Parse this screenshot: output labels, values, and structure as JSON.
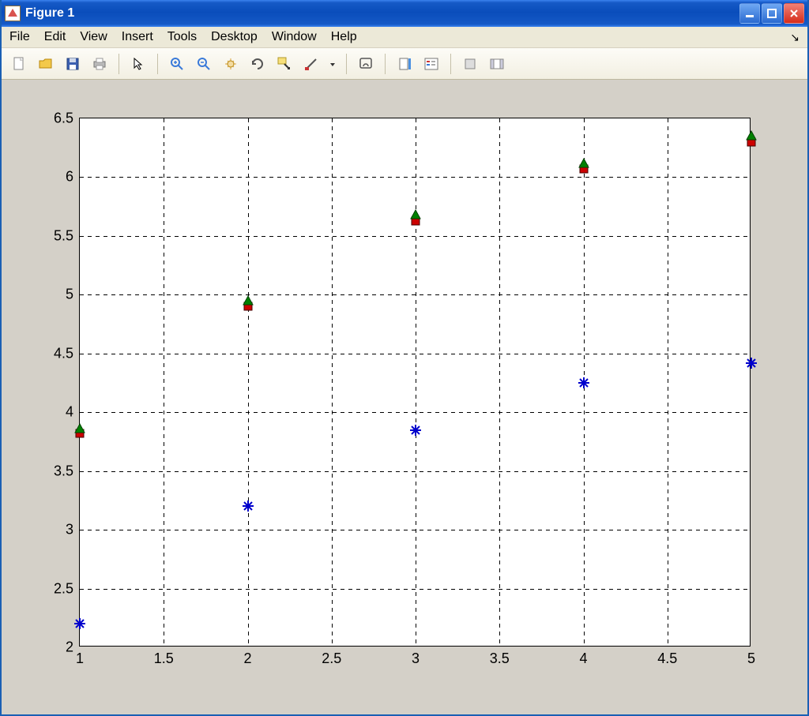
{
  "window": {
    "title": "Figure 1"
  },
  "menubar": {
    "items": [
      "File",
      "Edit",
      "View",
      "Insert",
      "Tools",
      "Desktop",
      "Window",
      "Help"
    ]
  },
  "toolbar": {
    "icons": [
      "new-file-icon",
      "open-folder-icon",
      "save-icon",
      "print-icon",
      "|",
      "pointer-icon",
      "|",
      "zoom-in-icon",
      "zoom-out-icon",
      "pan-icon",
      "rotate-icon",
      "data-cursor-icon",
      "brush-icon",
      "dropdown-icon",
      "|",
      "link-icon",
      "|",
      "colorbar-icon",
      "legend-icon",
      "|",
      "hide-icon",
      "dock-icon"
    ]
  },
  "chart_data": {
    "type": "scatter",
    "xlim": [
      1,
      5
    ],
    "ylim": [
      2,
      6.5
    ],
    "xticks": [
      1,
      1.5,
      2,
      2.5,
      3,
      3.5,
      4,
      4.5,
      5
    ],
    "yticks": [
      2,
      2.5,
      3,
      3.5,
      4,
      4.5,
      5,
      5.5,
      6,
      6.5
    ],
    "xtick_labels": [
      "1",
      "1.5",
      "2",
      "2.5",
      "3",
      "3.5",
      "4",
      "4.5",
      "5"
    ],
    "ytick_labels": [
      "2",
      "2.5",
      "3",
      "3.5",
      "4",
      "4.5",
      "5",
      "5.5",
      "6",
      "6.5"
    ],
    "x": [
      1,
      2,
      3,
      4,
      5
    ],
    "series": [
      {
        "name": "series-blue-star",
        "color": "#0000cc",
        "marker": "star",
        "values": [
          2.2,
          3.2,
          3.85,
          4.25,
          4.42
        ]
      },
      {
        "name": "series-red-square",
        "color": "#cc0000",
        "marker": "square",
        "values": [
          3.82,
          4.9,
          5.63,
          6.07,
          6.3
        ]
      },
      {
        "name": "series-green-tri",
        "color": "#008000",
        "marker": "triangle",
        "values": [
          3.86,
          4.95,
          5.68,
          6.12,
          6.35
        ]
      }
    ],
    "grid": true,
    "title": "",
    "xlabel": "",
    "ylabel": ""
  }
}
